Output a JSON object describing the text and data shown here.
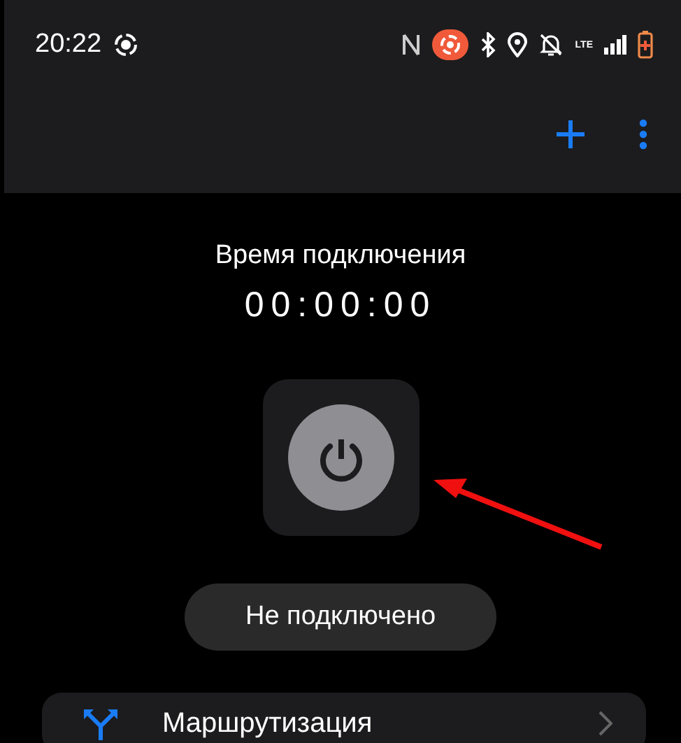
{
  "status_bar": {
    "time": "20:22",
    "network": "LTE"
  },
  "connection": {
    "title": "Время подключения",
    "timer": "00:00:00",
    "status": "Не подключено"
  },
  "menu": [
    {
      "label": "Маршрутизация"
    }
  ]
}
